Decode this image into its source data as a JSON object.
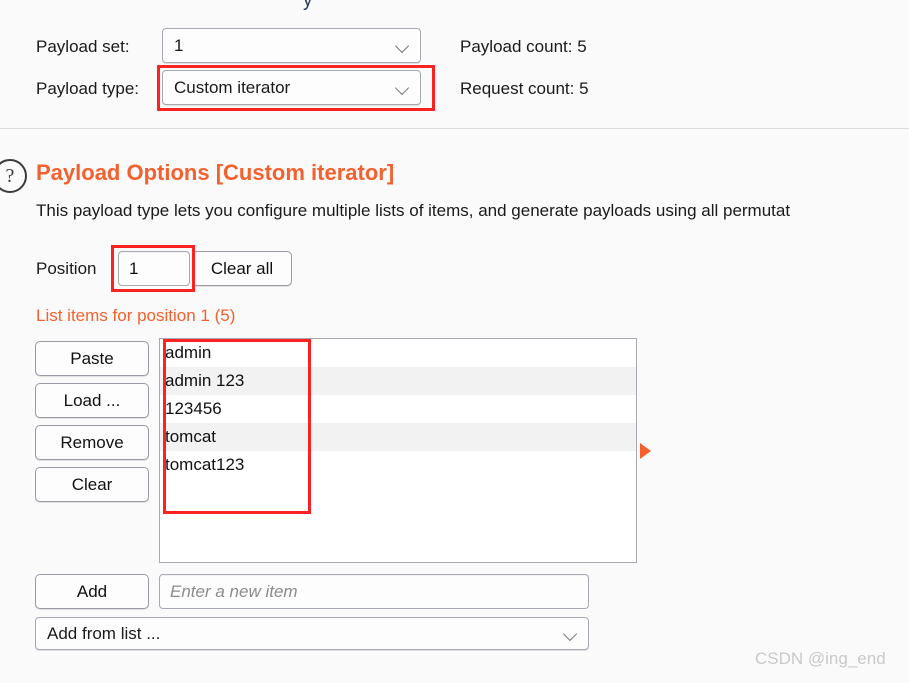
{
  "window": {
    "background_color": "#fafafa",
    "accent_orange": "#f4612f",
    "annotation_red": "#fb2222",
    "top_clipped_fragment": "y"
  },
  "payload_sets": {
    "set_label": "Payload set:",
    "set_value": "1",
    "type_label": "Payload type:",
    "type_value": "Custom iterator",
    "payload_count_label": "Payload count:  5",
    "request_count_label": "Request count:  5"
  },
  "payload_options": {
    "help_icon_glyph": "?",
    "title": "Payload Options [Custom iterator]",
    "description": "This payload type lets you configure multiple lists of items, and generate payloads using all permutat",
    "position_label": "Position",
    "position_value": "1",
    "clear_all_label": "Clear all"
  },
  "list_section": {
    "heading": "List items for position 1 (5)",
    "buttons": [
      {
        "label": "Paste"
      },
      {
        "label": "Load ..."
      },
      {
        "label": "Remove"
      },
      {
        "label": "Clear"
      }
    ],
    "items": [
      "admin",
      "admin 123",
      "123456",
      "tomcat",
      "tomcat123"
    ],
    "add_button_label": "Add",
    "new_item_placeholder": "Enter a new item",
    "add_from_list_label": "Add from list ..."
  },
  "watermark": {
    "text": "CSDN @ing_end"
  }
}
